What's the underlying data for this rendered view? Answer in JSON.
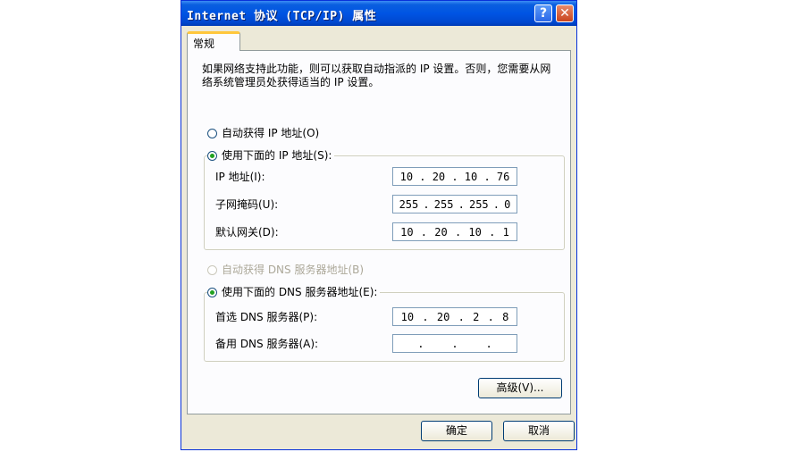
{
  "window": {
    "title": "Internet 协议 (TCP/IP) 属性",
    "help_glyph": "?",
    "close_glyph": "✕"
  },
  "tabs": [
    {
      "label": "常规"
    }
  ],
  "description": "如果网络支持此功能，则可以获取自动指派的 IP 设置。否则，您需要从网络系统管理员处获得适当的 IP 设置。",
  "ip_section": {
    "auto_label": "自动获得 IP 地址(O)",
    "manual_label": "使用下面的 IP 地址(S):",
    "fields": [
      {
        "label": "IP 地址(I):",
        "octets": [
          "10",
          "20",
          "10",
          "76"
        ]
      },
      {
        "label": "子网掩码(U):",
        "octets": [
          "255",
          "255",
          "255",
          "0"
        ]
      },
      {
        "label": "默认网关(D):",
        "octets": [
          "10",
          "20",
          "10",
          "1"
        ]
      }
    ]
  },
  "dns_section": {
    "auto_label": "自动获得 DNS 服务器地址(B)",
    "manual_label": "使用下面的 DNS 服务器地址(E):",
    "fields": [
      {
        "label": "首选 DNS 服务器(P):",
        "octets": [
          "10",
          "20",
          "2",
          "8"
        ]
      },
      {
        "label": "备用 DNS 服务器(A):",
        "octets": [
          "",
          "",
          "",
          ""
        ]
      }
    ]
  },
  "buttons": {
    "advanced": "高级(V)...",
    "ok": "确定",
    "cancel": "取消"
  },
  "colors": {
    "titlebar": "#0054e3",
    "tab_accent": "#ffc73c",
    "radio_dot": "#21a121",
    "dialog_bg": "#ece9d8"
  }
}
